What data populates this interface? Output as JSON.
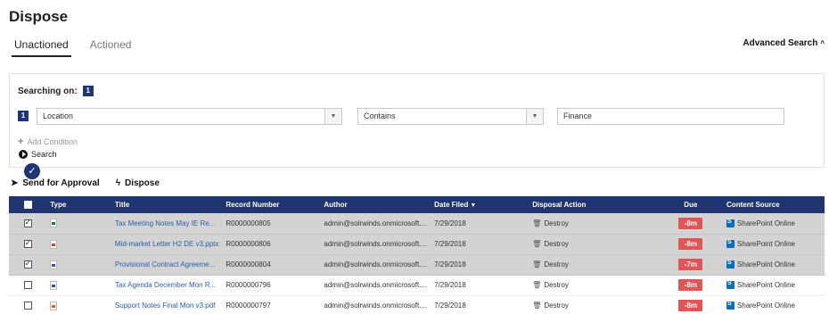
{
  "page": {
    "title": "Dispose"
  },
  "tabs": [
    {
      "label": "Unactioned",
      "active": true
    },
    {
      "label": "Actioned",
      "active": false
    }
  ],
  "advanced_search": {
    "label": "Advanced Search"
  },
  "search_panel": {
    "searching_on_label": "Searching on:",
    "condition_count": "1",
    "conditions": [
      {
        "index": "1",
        "field": "Location",
        "operator": "Contains",
        "value": "Finance"
      }
    ],
    "add_condition_label": "Add Condition",
    "search_label": "Search"
  },
  "actions": {
    "send_for_approval": "Send for Approval",
    "dispose": "Dispose"
  },
  "table": {
    "headers": {
      "type": "Type",
      "title": "Title",
      "record_number": "Record Number",
      "author": "Author",
      "date_filed": "Date Filed",
      "disposal_action": "Disposal Action",
      "due": "Due",
      "content_source": "Content Source"
    },
    "rows": [
      {
        "selected": true,
        "file_type": "xlsx",
        "title": "Tax Meeting Notes May IE Re...",
        "record_number": "R0000000805",
        "author": "admin@solrwinds.onmicrosoft....",
        "date_filed": "7/29/2018",
        "disposal_action": "Destroy",
        "due": "-8m",
        "content_source": "SharePoint Online"
      },
      {
        "selected": true,
        "file_type": "pptx",
        "title": "Mid-market Letter H2 DE v3.pptx",
        "record_number": "R0000000806",
        "author": "admin@solrwinds.onmicrosoft....",
        "date_filed": "7/29/2018",
        "disposal_action": "Destroy",
        "due": "-8m",
        "content_source": "SharePoint Online"
      },
      {
        "selected": true,
        "file_type": "docx",
        "title": "Provisional Contract Agreeme...",
        "record_number": "R0000000804",
        "author": "admin@solrwinds.onmicrosoft....",
        "date_filed": "7/29/2018",
        "disposal_action": "Destroy",
        "due": "-7m",
        "content_source": "SharePoint Online"
      },
      {
        "selected": false,
        "file_type": "docx",
        "title": "Tax Agenda December Mon R...",
        "record_number": "R0000000796",
        "author": "admin@solrwinds.onmicrosoft....",
        "date_filed": "7/29/2018",
        "disposal_action": "Destroy",
        "due": "-8m",
        "content_source": "SharePoint Online"
      },
      {
        "selected": false,
        "file_type": "pdf",
        "title": "Support Notes Final Mon v3.pdf",
        "record_number": "R0000000797",
        "author": "admin@solrwinds.onmicrosoft....",
        "date_filed": "7/29/2018",
        "disposal_action": "Destroy",
        "due": "-8m",
        "content_source": "SharePoint Online"
      }
    ]
  },
  "colors": {
    "header_bg": "#1f3470",
    "due_badge": "#e05555",
    "link": "#2a5ea8",
    "selected_row": "#d3d3d3"
  },
  "icons": {
    "send": "paper-plane-icon",
    "dispose": "lightning-icon",
    "action": "trash-icon",
    "source": "sharepoint-icon"
  }
}
